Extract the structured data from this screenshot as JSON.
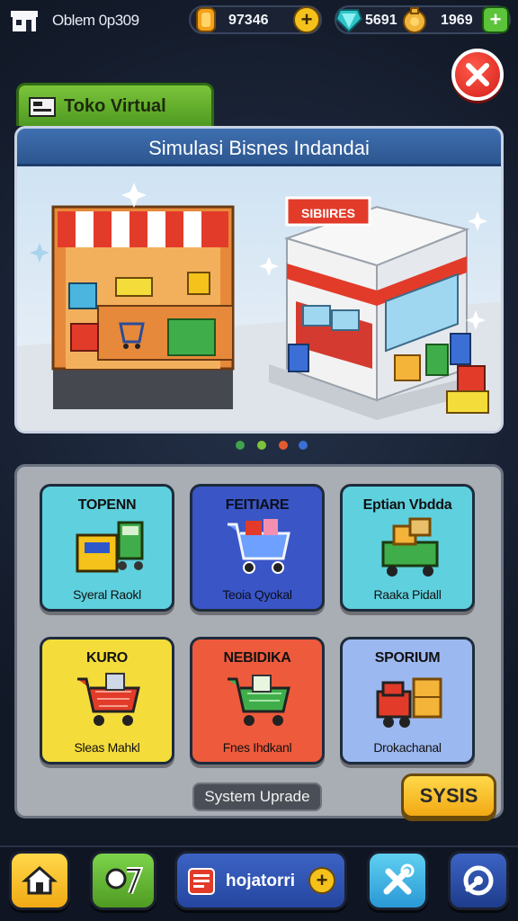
{
  "topbar": {
    "player_name": "Oblem 0p309",
    "resources": [
      {
        "name": "coins",
        "value": "97346",
        "icon": "coin-icon",
        "color": "#f4a21b"
      },
      {
        "name": "gems",
        "value": "5691",
        "value2": "1969",
        "icon": "gem-icon",
        "color": "#2ec4c9"
      }
    ]
  },
  "store_tab": {
    "label": "Toko Virtual",
    "icon": "register-icon"
  },
  "banner": {
    "title": "Simulasi Bisnes Indandai",
    "shop_sign": "SIBIIRES",
    "page_dots": [
      "#3fa34d",
      "#7cc43a",
      "#e55b2f",
      "#3b6fd6"
    ]
  },
  "categories": [
    {
      "title": "TOPENN",
      "subtitle": "Syeral Raokl",
      "color": "#5fd0de",
      "icon": "storage-bins-icon"
    },
    {
      "title": "FEITIARE",
      "subtitle": "Teoia Qyokal",
      "color": "#3a55c6",
      "icon": "shopping-cart-icon"
    },
    {
      "title": "Eptian Vbdda",
      "subtitle": "Raaka Pidall",
      "color": "#5fd0de",
      "icon": "delivery-cart-icon"
    },
    {
      "title": "KURO",
      "subtitle": "Sleas Mahkl",
      "color": "#f4dc3b",
      "icon": "red-cart-icon"
    },
    {
      "title": "NEBIDIKA",
      "subtitle": "Fnes Ihdkanl",
      "color": "#ee5a3c",
      "icon": "green-cart-icon"
    },
    {
      "title": "SPORIUM",
      "subtitle": "Drokachanal",
      "color": "#9cb8f0",
      "icon": "cargo-truck-icon"
    }
  ],
  "upgrade_label": "System Uprade",
  "action_button": "SYSIS",
  "bottom_nav": {
    "inventory_label": "hojatorri",
    "items": [
      "home-icon",
      "badge-icon",
      "inventory-icon",
      "tools-icon",
      "settings-icon"
    ]
  }
}
